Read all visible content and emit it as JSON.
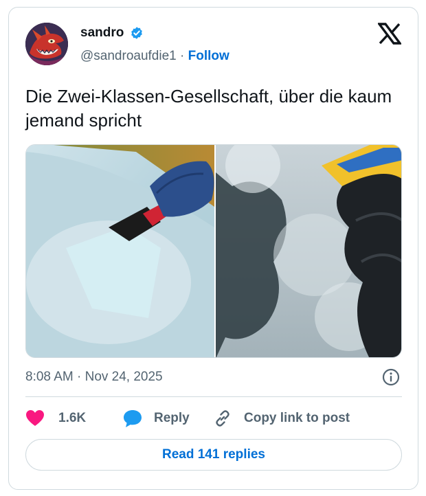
{
  "author": {
    "display_name": "sandro",
    "handle": "@sandroaufdie1",
    "separator": "·",
    "follow_label": "Follow",
    "verified": true
  },
  "tweet": {
    "text": "Die Zwei-Klassen-Gesellschaft, über die kaum jemand spricht",
    "timestamp": "8:08 AM · Nov 24, 2025"
  },
  "actions": {
    "like_count": "1.6K",
    "reply_label": "Reply",
    "copy_link_label": "Copy link to post"
  },
  "read_replies_label": "Read 141 replies",
  "icons": {
    "logo": "x-logo-icon",
    "verified": "verified-badge-icon",
    "info": "info-icon",
    "like": "heart-icon",
    "reply": "speech-bubble-icon",
    "copy_link": "link-icon"
  },
  "colors": {
    "accent": "#006fd6",
    "verified": "#1d9bf0",
    "like": "#f91880",
    "secondary_text": "#536471",
    "border": "#cfd9de"
  }
}
